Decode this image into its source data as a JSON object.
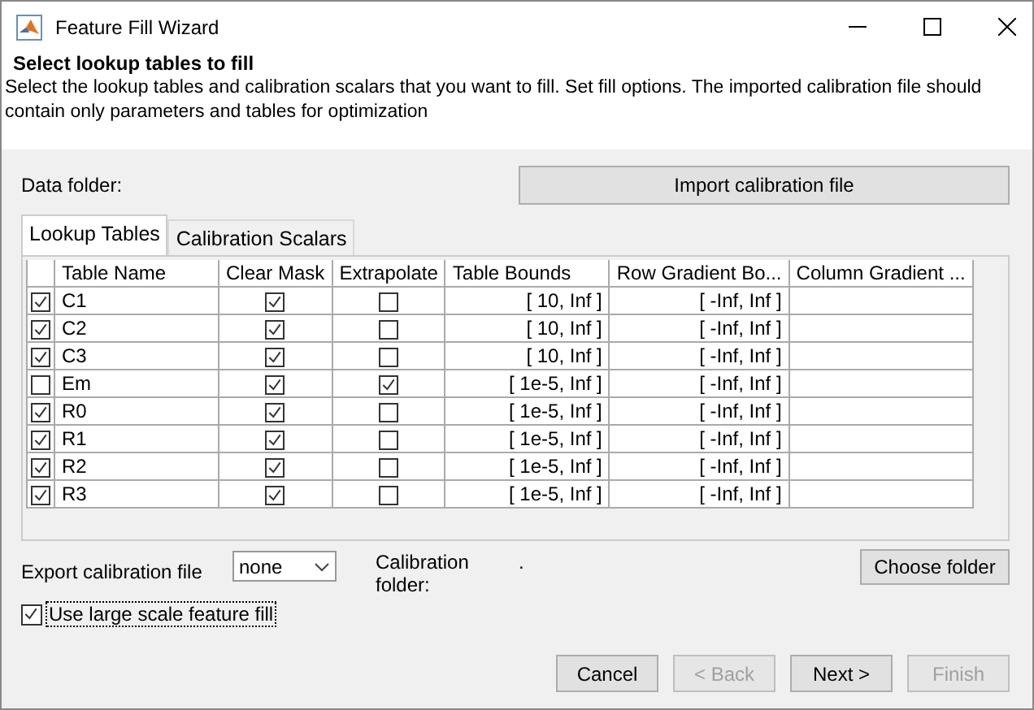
{
  "window": {
    "title": "Feature Fill Wizard"
  },
  "header": {
    "title": "Select lookup tables to fill",
    "description": "Select the lookup tables and calibration scalars that you want to fill. Set fill options. The imported calibration file should contain only parameters and tables for optimization"
  },
  "data_folder_label": "Data folder:",
  "import_button": "Import calibration file",
  "tabs": [
    {
      "label": "Lookup Tables",
      "selected": true
    },
    {
      "label": "Calibration Scalars",
      "selected": false
    }
  ],
  "table": {
    "columns": [
      "Table Name",
      "Clear Mask",
      "Extrapolate",
      "Table Bounds",
      "Row Gradient Bo...",
      "Column Gradient ..."
    ],
    "rows": [
      {
        "checked": true,
        "name": "C1",
        "clear_mask": true,
        "extrapolate": false,
        "table_bounds": "[ 10, Inf ]",
        "row_gradient": "[ -Inf, Inf ]"
      },
      {
        "checked": true,
        "name": "C2",
        "clear_mask": true,
        "extrapolate": false,
        "table_bounds": "[ 10, Inf ]",
        "row_gradient": "[ -Inf, Inf ]"
      },
      {
        "checked": true,
        "name": "C3",
        "clear_mask": true,
        "extrapolate": false,
        "table_bounds": "[ 10, Inf ]",
        "row_gradient": "[ -Inf, Inf ]"
      },
      {
        "checked": false,
        "name": "Em",
        "clear_mask": true,
        "extrapolate": true,
        "table_bounds": "[ 1e-5, Inf ]",
        "row_gradient": "[ -Inf, Inf ]"
      },
      {
        "checked": true,
        "name": "R0",
        "clear_mask": true,
        "extrapolate": false,
        "table_bounds": "[ 1e-5, Inf ]",
        "row_gradient": "[ -Inf, Inf ]"
      },
      {
        "checked": true,
        "name": "R1",
        "clear_mask": true,
        "extrapolate": false,
        "table_bounds": "[ 1e-5, Inf ]",
        "row_gradient": "[ -Inf, Inf ]"
      },
      {
        "checked": true,
        "name": "R2",
        "clear_mask": true,
        "extrapolate": false,
        "table_bounds": "[ 1e-5, Inf ]",
        "row_gradient": "[ -Inf, Inf ]"
      },
      {
        "checked": true,
        "name": "R3",
        "clear_mask": true,
        "extrapolate": false,
        "table_bounds": "[ 1e-5, Inf ]",
        "row_gradient": "[ -Inf, Inf ]"
      }
    ]
  },
  "export": {
    "label": "Export calibration file",
    "value": "none"
  },
  "calibration_folder": {
    "label": "Calibration folder:",
    "value": "."
  },
  "choose_folder_button": "Choose folder",
  "large_scale": {
    "label": "Use large scale feature fill",
    "checked": true
  },
  "buttons": [
    {
      "label": "Cancel",
      "disabled": false
    },
    {
      "label": "< Back",
      "disabled": true
    },
    {
      "label": "Next >",
      "disabled": false
    },
    {
      "label": "Finish",
      "disabled": true
    }
  ]
}
